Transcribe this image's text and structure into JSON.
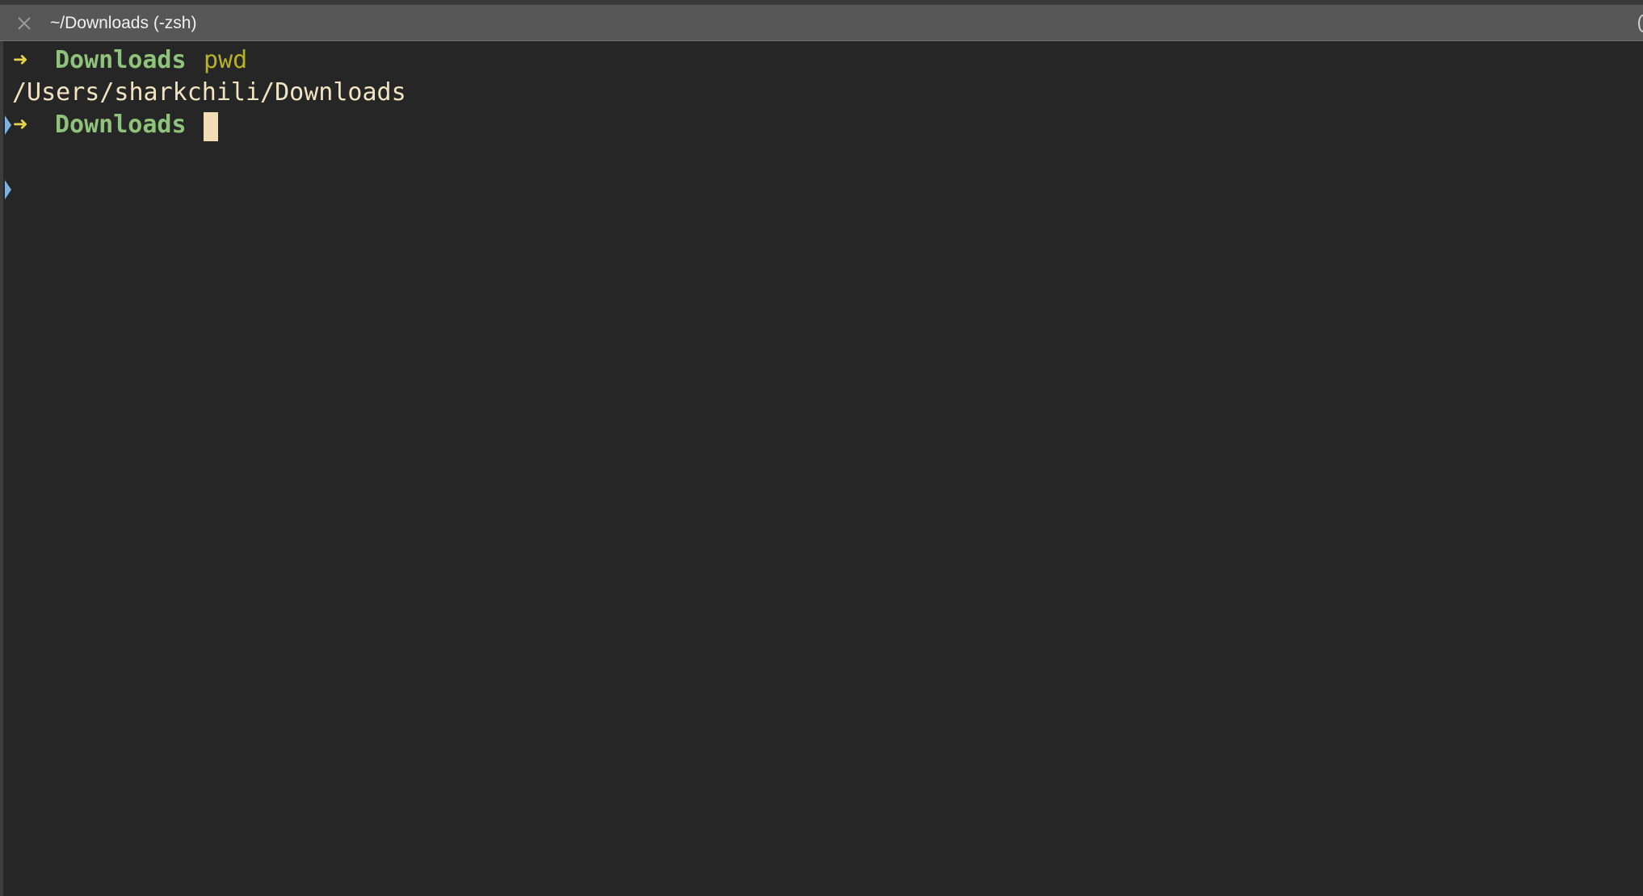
{
  "tab": {
    "title": "~/Downloads (-zsh)",
    "close_icon": "close-icon"
  },
  "terminal": {
    "lines": [
      {
        "prompt_symbol": "➜",
        "cwd": "Downloads",
        "command": "pwd"
      },
      {
        "output": "/Users/sharkchili/Downloads"
      },
      {
        "prompt_symbol": "➜",
        "cwd": "Downloads",
        "command": ""
      }
    ]
  },
  "colors": {
    "background": "#262626",
    "tabbar": "#575757",
    "prompt_arrow": "#e6d24a",
    "cwd": "#8fc27a",
    "command": "#b5b227",
    "output": "#f2e3c1",
    "cursor": "#f2deb5",
    "marker": "#7fb2e0"
  }
}
